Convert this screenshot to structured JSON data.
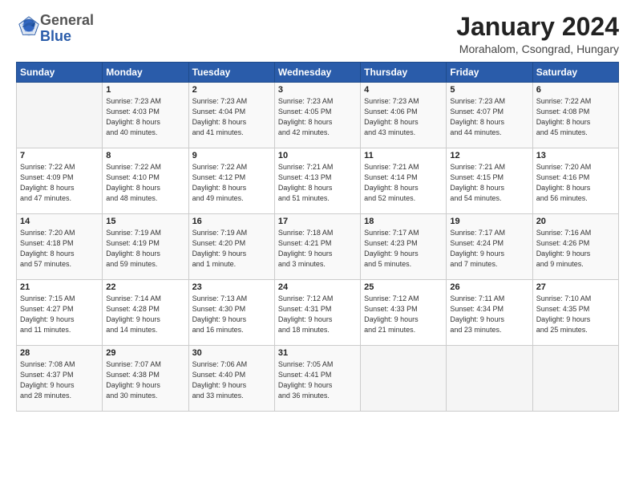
{
  "header": {
    "logo_general": "General",
    "logo_blue": "Blue",
    "title": "January 2024",
    "subtitle": "Morahalom, Csongrad, Hungary"
  },
  "days_of_week": [
    "Sunday",
    "Monday",
    "Tuesday",
    "Wednesday",
    "Thursday",
    "Friday",
    "Saturday"
  ],
  "weeks": [
    [
      {
        "day": "",
        "sunrise": "",
        "sunset": "",
        "daylight": ""
      },
      {
        "day": "1",
        "sunrise": "Sunrise: 7:23 AM",
        "sunset": "Sunset: 4:03 PM",
        "daylight": "Daylight: 8 hours and 40 minutes."
      },
      {
        "day": "2",
        "sunrise": "Sunrise: 7:23 AM",
        "sunset": "Sunset: 4:04 PM",
        "daylight": "Daylight: 8 hours and 41 minutes."
      },
      {
        "day": "3",
        "sunrise": "Sunrise: 7:23 AM",
        "sunset": "Sunset: 4:05 PM",
        "daylight": "Daylight: 8 hours and 42 minutes."
      },
      {
        "day": "4",
        "sunrise": "Sunrise: 7:23 AM",
        "sunset": "Sunset: 4:06 PM",
        "daylight": "Daylight: 8 hours and 43 minutes."
      },
      {
        "day": "5",
        "sunrise": "Sunrise: 7:23 AM",
        "sunset": "Sunset: 4:07 PM",
        "daylight": "Daylight: 8 hours and 44 minutes."
      },
      {
        "day": "6",
        "sunrise": "Sunrise: 7:22 AM",
        "sunset": "Sunset: 4:08 PM",
        "daylight": "Daylight: 8 hours and 45 minutes."
      }
    ],
    [
      {
        "day": "7",
        "sunrise": "Sunrise: 7:22 AM",
        "sunset": "Sunset: 4:09 PM",
        "daylight": "Daylight: 8 hours and 47 minutes."
      },
      {
        "day": "8",
        "sunrise": "Sunrise: 7:22 AM",
        "sunset": "Sunset: 4:10 PM",
        "daylight": "Daylight: 8 hours and 48 minutes."
      },
      {
        "day": "9",
        "sunrise": "Sunrise: 7:22 AM",
        "sunset": "Sunset: 4:12 PM",
        "daylight": "Daylight: 8 hours and 49 minutes."
      },
      {
        "day": "10",
        "sunrise": "Sunrise: 7:21 AM",
        "sunset": "Sunset: 4:13 PM",
        "daylight": "Daylight: 8 hours and 51 minutes."
      },
      {
        "day": "11",
        "sunrise": "Sunrise: 7:21 AM",
        "sunset": "Sunset: 4:14 PM",
        "daylight": "Daylight: 8 hours and 52 minutes."
      },
      {
        "day": "12",
        "sunrise": "Sunrise: 7:21 AM",
        "sunset": "Sunset: 4:15 PM",
        "daylight": "Daylight: 8 hours and 54 minutes."
      },
      {
        "day": "13",
        "sunrise": "Sunrise: 7:20 AM",
        "sunset": "Sunset: 4:16 PM",
        "daylight": "Daylight: 8 hours and 56 minutes."
      }
    ],
    [
      {
        "day": "14",
        "sunrise": "Sunrise: 7:20 AM",
        "sunset": "Sunset: 4:18 PM",
        "daylight": "Daylight: 8 hours and 57 minutes."
      },
      {
        "day": "15",
        "sunrise": "Sunrise: 7:19 AM",
        "sunset": "Sunset: 4:19 PM",
        "daylight": "Daylight: 8 hours and 59 minutes."
      },
      {
        "day": "16",
        "sunrise": "Sunrise: 7:19 AM",
        "sunset": "Sunset: 4:20 PM",
        "daylight": "Daylight: 9 hours and 1 minute."
      },
      {
        "day": "17",
        "sunrise": "Sunrise: 7:18 AM",
        "sunset": "Sunset: 4:21 PM",
        "daylight": "Daylight: 9 hours and 3 minutes."
      },
      {
        "day": "18",
        "sunrise": "Sunrise: 7:17 AM",
        "sunset": "Sunset: 4:23 PM",
        "daylight": "Daylight: 9 hours and 5 minutes."
      },
      {
        "day": "19",
        "sunrise": "Sunrise: 7:17 AM",
        "sunset": "Sunset: 4:24 PM",
        "daylight": "Daylight: 9 hours and 7 minutes."
      },
      {
        "day": "20",
        "sunrise": "Sunrise: 7:16 AM",
        "sunset": "Sunset: 4:26 PM",
        "daylight": "Daylight: 9 hours and 9 minutes."
      }
    ],
    [
      {
        "day": "21",
        "sunrise": "Sunrise: 7:15 AM",
        "sunset": "Sunset: 4:27 PM",
        "daylight": "Daylight: 9 hours and 11 minutes."
      },
      {
        "day": "22",
        "sunrise": "Sunrise: 7:14 AM",
        "sunset": "Sunset: 4:28 PM",
        "daylight": "Daylight: 9 hours and 14 minutes."
      },
      {
        "day": "23",
        "sunrise": "Sunrise: 7:13 AM",
        "sunset": "Sunset: 4:30 PM",
        "daylight": "Daylight: 9 hours and 16 minutes."
      },
      {
        "day": "24",
        "sunrise": "Sunrise: 7:12 AM",
        "sunset": "Sunset: 4:31 PM",
        "daylight": "Daylight: 9 hours and 18 minutes."
      },
      {
        "day": "25",
        "sunrise": "Sunrise: 7:12 AM",
        "sunset": "Sunset: 4:33 PM",
        "daylight": "Daylight: 9 hours and 21 minutes."
      },
      {
        "day": "26",
        "sunrise": "Sunrise: 7:11 AM",
        "sunset": "Sunset: 4:34 PM",
        "daylight": "Daylight: 9 hours and 23 minutes."
      },
      {
        "day": "27",
        "sunrise": "Sunrise: 7:10 AM",
        "sunset": "Sunset: 4:35 PM",
        "daylight": "Daylight: 9 hours and 25 minutes."
      }
    ],
    [
      {
        "day": "28",
        "sunrise": "Sunrise: 7:08 AM",
        "sunset": "Sunset: 4:37 PM",
        "daylight": "Daylight: 9 hours and 28 minutes."
      },
      {
        "day": "29",
        "sunrise": "Sunrise: 7:07 AM",
        "sunset": "Sunset: 4:38 PM",
        "daylight": "Daylight: 9 hours and 30 minutes."
      },
      {
        "day": "30",
        "sunrise": "Sunrise: 7:06 AM",
        "sunset": "Sunset: 4:40 PM",
        "daylight": "Daylight: 9 hours and 33 minutes."
      },
      {
        "day": "31",
        "sunrise": "Sunrise: 7:05 AM",
        "sunset": "Sunset: 4:41 PM",
        "daylight": "Daylight: 9 hours and 36 minutes."
      },
      {
        "day": "",
        "sunrise": "",
        "sunset": "",
        "daylight": ""
      },
      {
        "day": "",
        "sunrise": "",
        "sunset": "",
        "daylight": ""
      },
      {
        "day": "",
        "sunrise": "",
        "sunset": "",
        "daylight": ""
      }
    ]
  ]
}
